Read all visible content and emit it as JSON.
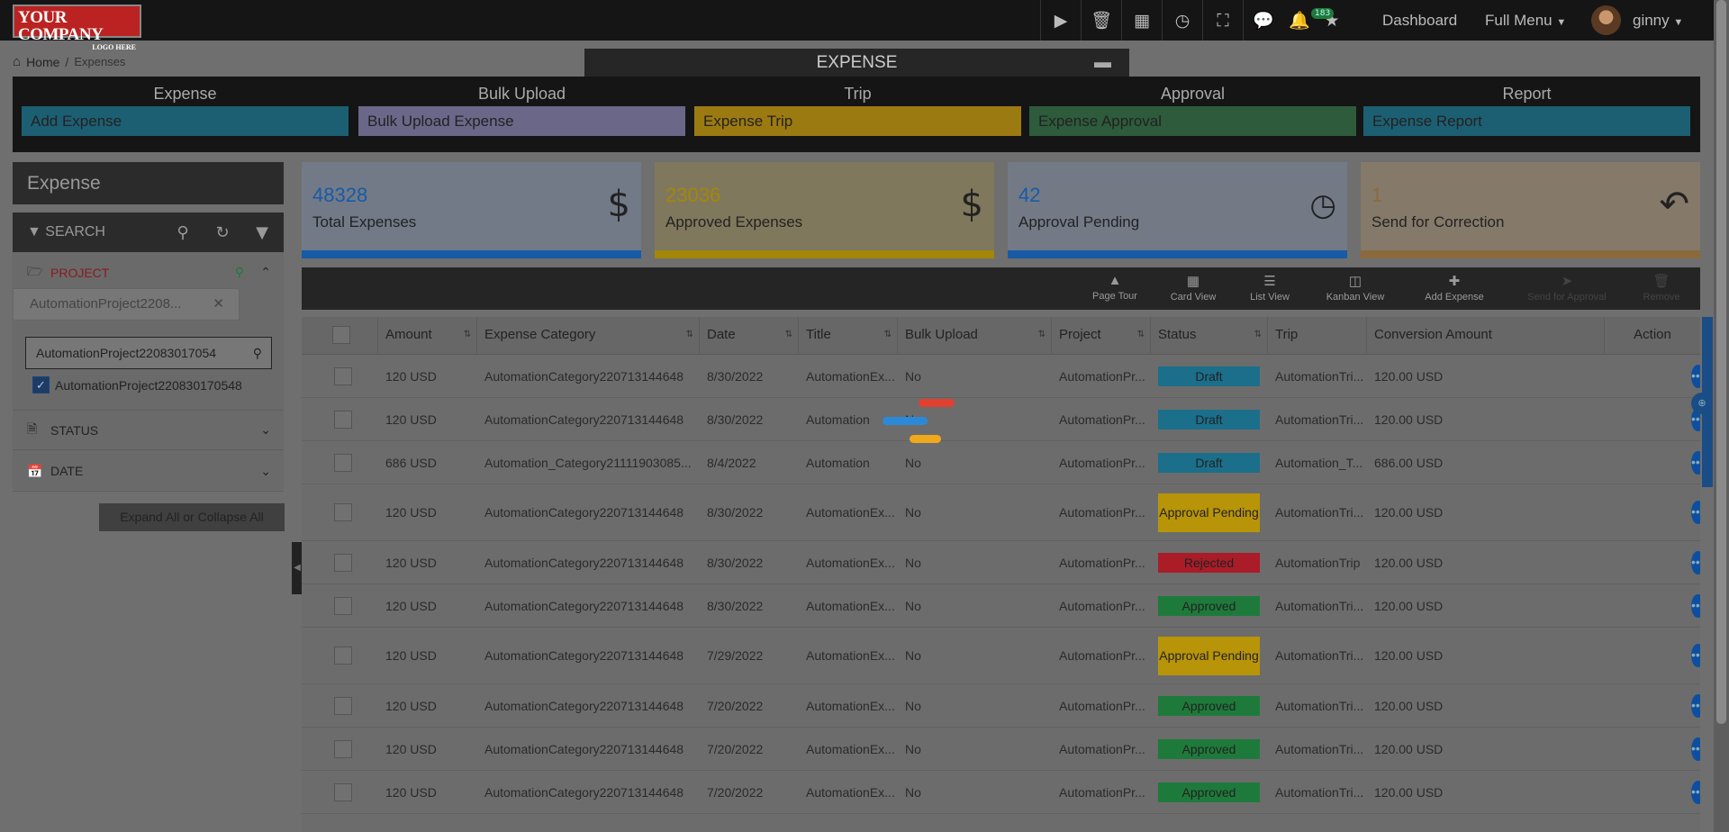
{
  "logo": {
    "line1": "YOUR COMPANY",
    "line2": "LOGO HERE"
  },
  "topbar": {
    "notification_count": "183",
    "dashboard": "Dashboard",
    "full_menu": "Full Menu",
    "username": "ginny",
    "icons": [
      "play-icon",
      "trash-icon",
      "org-chart-icon",
      "clock-icon",
      "fullscreen-icon",
      "chat-icon",
      "bell-icon",
      "star-icon"
    ]
  },
  "breadcrumb": {
    "home": "Home",
    "separator": "/",
    "current": "Expenses"
  },
  "module": {
    "title": "EXPENSE",
    "columns": [
      {
        "heading": "Expense",
        "button": "Add Expense",
        "color": "#1d5f72"
      },
      {
        "heading": "Bulk Upload",
        "button": "Bulk Upload Expense",
        "color": "#6b6789"
      },
      {
        "heading": "Trip",
        "button": "Expense Trip",
        "color": "#9c7a12"
      },
      {
        "heading": "Approval",
        "button": "Expense Approval",
        "color": "#2d5b3c"
      },
      {
        "heading": "Report",
        "button": "Expense Report",
        "color": "#1d5f72"
      }
    ]
  },
  "sidebar": {
    "title": "Expense",
    "search_label": "SEARCH",
    "project_label": "PROJECT",
    "project_chip": "AutomationProject2208...",
    "filter_value": "AutomationProject22083017054",
    "checkbox_label": "AutomationProject220830170548",
    "status_label": "STATUS",
    "date_label": "DATE",
    "expand_button": "Expand All or Collapse All"
  },
  "cards": [
    {
      "value": "48328",
      "label": "Total Expenses",
      "icon": "dollar-icon",
      "color": "#175ba6",
      "bg": "#727a88"
    },
    {
      "value": "23036",
      "label": "Approved Expenses",
      "icon": "dollar-icon",
      "color": "#a38708",
      "bg": "#80785c"
    },
    {
      "value": "42",
      "label": "Approval Pending",
      "icon": "clock-icon",
      "color": "#175ba6",
      "bg": "#737a86"
    },
    {
      "value": "1",
      "label": "Send for Correction",
      "icon": "reply-icon",
      "color": "#8a6a3c",
      "bg": "#857a6a"
    }
  ],
  "toolbar": [
    {
      "label": "Page Tour",
      "icon": "tour-icon"
    },
    {
      "label": "Card View",
      "icon": "grid-icon"
    },
    {
      "label": "List View",
      "icon": "list-icon"
    },
    {
      "label": "Kanban View",
      "icon": "kanban-icon"
    },
    {
      "label": "Add Expense",
      "icon": "plus-icon"
    },
    {
      "label": "Send for Approval",
      "icon": "send-icon"
    },
    {
      "label": "Remove",
      "icon": "trash-icon"
    }
  ],
  "table": {
    "headers": [
      "Amount",
      "Expense Category",
      "Date",
      "Title",
      "Bulk Upload",
      "Project",
      "Status",
      "Trip",
      "Conversion Amount",
      "Action"
    ],
    "rows": [
      {
        "amount": "120 USD",
        "category": "AutomationCategory220713144648",
        "date": "8/30/2022",
        "title": "AutomationEx...",
        "bulk": "No",
        "project": "AutomationPr...",
        "status": "Draft",
        "trip": "AutomationTri...",
        "conv": "120.00 USD"
      },
      {
        "amount": "120 USD",
        "category": "AutomationCategory220713144648",
        "date": "8/30/2022",
        "title": "Automation",
        "bulk": "No",
        "project": "AutomationPr...",
        "status": "Draft",
        "trip": "AutomationTri...",
        "conv": "120.00 USD"
      },
      {
        "amount": "686 USD",
        "category": "Automation_Category21111903085...",
        "date": "8/4/2022",
        "title": "Automation",
        "bulk": "No",
        "project": "AutomationPr...",
        "status": "Draft",
        "trip": "Automation_T...",
        "conv": "686.00 USD"
      },
      {
        "amount": "120 USD",
        "category": "AutomationCategory220713144648",
        "date": "8/30/2022",
        "title": "AutomationEx...",
        "bulk": "No",
        "project": "AutomationPr...",
        "status": "Approval Pending",
        "trip": "AutomationTri...",
        "conv": "120.00 USD"
      },
      {
        "amount": "120 USD",
        "category": "AutomationCategory220713144648",
        "date": "8/30/2022",
        "title": "AutomationEx...",
        "bulk": "No",
        "project": "AutomationPr...",
        "status": "Rejected",
        "trip": "AutomationTrip",
        "conv": "120.00 USD"
      },
      {
        "amount": "120 USD",
        "category": "AutomationCategory220713144648",
        "date": "8/30/2022",
        "title": "AutomationEx...",
        "bulk": "No",
        "project": "AutomationPr...",
        "status": "Approved",
        "trip": "AutomationTri...",
        "conv": "120.00 USD"
      },
      {
        "amount": "120 USD",
        "category": "AutomationCategory220713144648",
        "date": "7/29/2022",
        "title": "AutomationEx...",
        "bulk": "No",
        "project": "AutomationPr...",
        "status": "Approval Pending",
        "trip": "AutomationTri...",
        "conv": "120.00 USD"
      },
      {
        "amount": "120 USD",
        "category": "AutomationCategory220713144648",
        "date": "7/20/2022",
        "title": "AutomationEx...",
        "bulk": "No",
        "project": "AutomationPr...",
        "status": "Approved",
        "trip": "AutomationTri...",
        "conv": "120.00 USD"
      },
      {
        "amount": "120 USD",
        "category": "AutomationCategory220713144648",
        "date": "7/20/2022",
        "title": "AutomationEx...",
        "bulk": "No",
        "project": "AutomationPr...",
        "status": "Approved",
        "trip": "AutomationTri...",
        "conv": "120.00 USD"
      },
      {
        "amount": "120 USD",
        "category": "AutomationCategory220713144648",
        "date": "7/20/2022",
        "title": "AutomationEx...",
        "bulk": "No",
        "project": "AutomationPr...",
        "status": "Approved",
        "trip": "AutomationTri...",
        "conv": "120.00 USD"
      }
    ]
  },
  "loader_colors": [
    "#e0402f",
    "#2b8ad8",
    "#f0a91d"
  ]
}
